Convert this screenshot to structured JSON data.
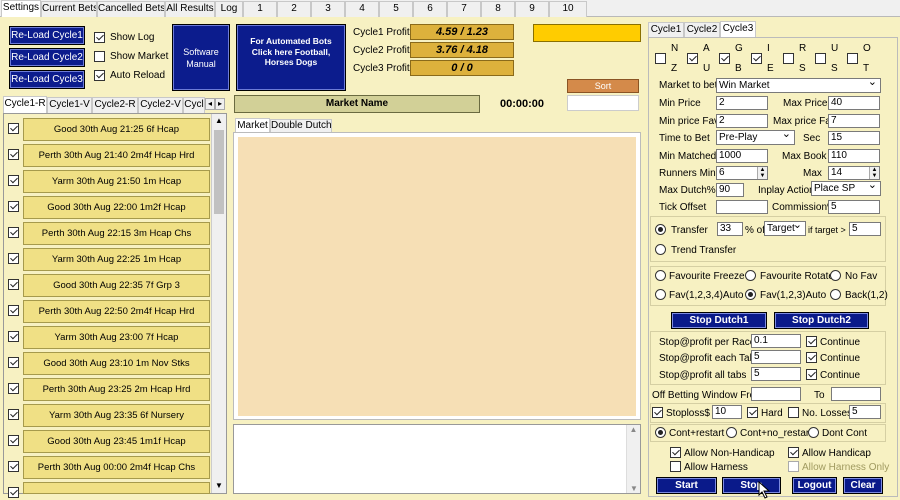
{
  "main_tabs": [
    "Settings",
    "Current Bets",
    "Cancelled Bets",
    "All Results",
    "Log",
    "1",
    "2",
    "3",
    "4",
    "5",
    "6",
    "7",
    "8",
    "9",
    "10"
  ],
  "reload_buttons": [
    "Re-Load Cycle1",
    "Re-Load Cycle2",
    "Re-Load Cycle3"
  ],
  "toggles": {
    "show_log": "Show Log",
    "show_market": "Show Market",
    "auto_reload": "Auto Reload"
  },
  "software_manual": "Software Manual",
  "promo": "For Automated Bots Click here Football, Horses Dogs",
  "profits": [
    {
      "label": "Cycle1 Profit",
      "value": "4.59 /  1.23"
    },
    {
      "label": "Cycle2 Profit",
      "value": "3.76 /  4.18"
    },
    {
      "label": "Cycle3 Profit",
      "value": "0 / 0"
    }
  ],
  "colors": {
    "status_box": "#ffcc00",
    "sort_button": "#d48a4a",
    "race_fill": "#f0e085",
    "panel_bg": "#f7f1c2",
    "blue_button": "#0c1c8d"
  },
  "sort_label": "Sort",
  "market_name_label": "Market Name",
  "clock": "00:00:00",
  "cycle_tabs": [
    "Cycle1-R",
    "Cycle1-V",
    "Cycle2-R",
    "Cycle2-V",
    "Cycl"
  ],
  "races": [
    "Good  30th Aug 21:25 6f Hcap",
    "Perth  30th Aug 21:40 2m4f Hcap Hrd",
    "Yarm  30th Aug 21:50 1m Hcap",
    "Good  30th Aug 22:00 1m2f Hcap",
    "Perth  30th Aug 22:15 3m Hcap Chs",
    "Yarm  30th Aug 22:25 1m Hcap",
    "Good  30th Aug 22:35 7f Grp 3",
    "Perth  30th Aug 22:50 2m4f Hcap Hrd",
    "Yarm  30th Aug 23:00 7f Hcap",
    "Good  30th Aug 23:10 1m Nov Stks",
    "Perth  30th Aug 23:25 2m Hcap Hrd",
    "Yarm  30th Aug 23:35 6f Nursery",
    "Good  30th Aug 23:45 1m1f Hcap",
    "Perth  30th Aug 00:00 2m4f Hcap Chs"
  ],
  "market_tabs": [
    "Market",
    "Double Dutch"
  ],
  "right_tabs": [
    "Cycle1",
    "Cycle2",
    "Cycle3"
  ],
  "countries": [
    {
      "top": "N",
      "bottom": "Z",
      "checked": false
    },
    {
      "top": "A",
      "bottom": "U",
      "checked": true
    },
    {
      "top": "G",
      "bottom": "B",
      "checked": true
    },
    {
      "top": "I",
      "bottom": "E",
      "checked": true
    },
    {
      "top": "R",
      "bottom": "S",
      "checked": false
    },
    {
      "top": "U",
      "bottom": "S",
      "checked": false
    },
    {
      "top": "O",
      "bottom": "T",
      "checked": false
    }
  ],
  "settings": {
    "market_to_bet_label": "Market to bet",
    "market_to_bet": "Win Market",
    "min_price_label": "Min Price",
    "min_price": "2",
    "max_price_label": "Max Price",
    "max_price": "40",
    "min_price_fav_label": "Min price Fav",
    "min_price_fav": "2",
    "max_price_fav_label": "Max price Fav",
    "max_price_fav": "7",
    "time_to_bet_label": "Time to Bet",
    "time_to_bet": "Pre-Play",
    "sec_label": "Sec",
    "sec": "15",
    "min_matched_label": "Min Matched",
    "min_matched": "1000",
    "max_book_label": "Max Book %",
    "max_book": "110",
    "runners_min_label": "Runners Min",
    "runners_min": "6",
    "runners_max_label": "Max",
    "runners_max": "14",
    "max_dutch_label": "Max Dutch%",
    "max_dutch": "90",
    "inplay_action_label": "Inplay Action",
    "inplay_action": "Place SP",
    "tick_offset_label": "Tick Offset",
    "commission_label": "Commission%",
    "commission": "5"
  },
  "transfer": {
    "label": "Transfer",
    "value": "33",
    "of_label": "% of",
    "target": "Target",
    "if_label": "if target >",
    "if_value": "5",
    "trend_label": "Trend Transfer"
  },
  "fav_options": [
    "Favourite Freeze",
    "Favourite Rotate",
    "No Fav",
    "Fav(1,2,3,4)Auto",
    "Fav(1,2,3)Auto",
    "Back(1,2)"
  ],
  "stop_dutch": [
    "Stop Dutch1",
    "Stop Dutch2"
  ],
  "stop_profit": [
    {
      "label": "Stop@profit per Race",
      "value": "0.1"
    },
    {
      "label": "Stop@profit each Tab",
      "value": "5"
    },
    {
      "label": "Stop@profit all tabs",
      "value": "5"
    }
  ],
  "continue_label": "Continue",
  "off_window": {
    "label": "Off Betting Window From",
    "to_label": "To"
  },
  "stoploss": {
    "label": "Stoploss$",
    "value": "10",
    "hard_label": "Hard",
    "losses_label": "No. Losses",
    "losses_value": "5"
  },
  "restart_options": [
    "Cont+restart",
    "Cont+no_restart",
    "Dont Cont"
  ],
  "allow": {
    "non_handicap": "Allow Non-Handicap",
    "handicap": "Allow Handicap",
    "harness": "Allow Harness",
    "harness_only": "Allow Harness Only"
  },
  "bottom_buttons": [
    "Start",
    "Stop",
    "Logout",
    "Clear"
  ]
}
